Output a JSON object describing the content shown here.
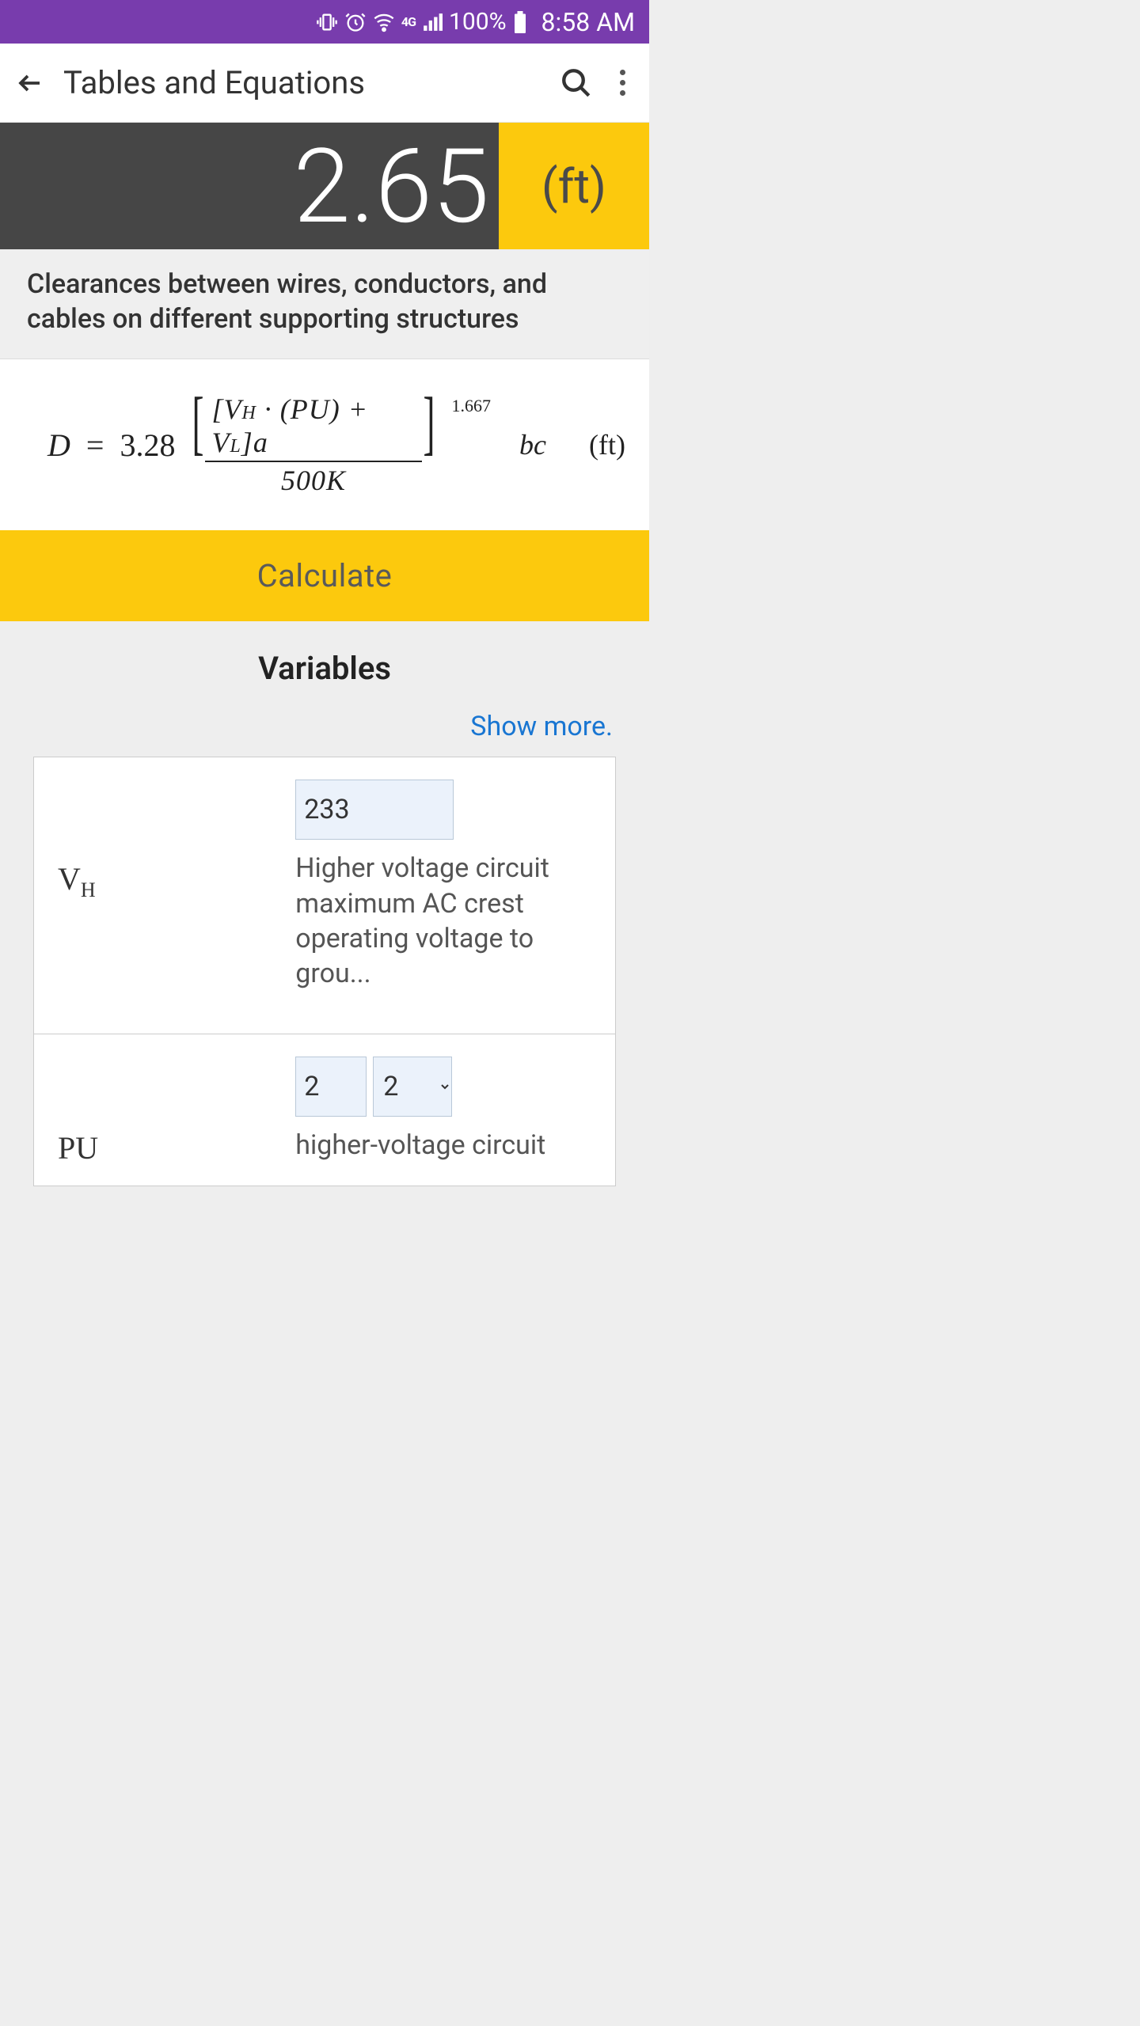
{
  "status": {
    "network_indicator": "4G",
    "battery_pct": "100%",
    "time": "8:58 AM"
  },
  "appbar": {
    "title": "Tables and Equations"
  },
  "result": {
    "value": "2.65",
    "unit": "(ft)"
  },
  "subtitle": "Clearances between wires, conductors, and cables on different supporting structures",
  "equation": {
    "lhs": "D",
    "equals": "=",
    "const": "3.28",
    "numerator": "[V_H · (PU) + V_L]a",
    "denominator": "500K",
    "exponent": "1.667",
    "extra": "bc",
    "unit": "(ft)"
  },
  "calc_label": "Calculate",
  "variables": {
    "heading": "Variables",
    "show_more": "Show more.",
    "rows": [
      {
        "label_html": "V_H",
        "input_value": "233",
        "desc": "Higher voltage circuit maximum AC crest operating voltage to grou..."
      },
      {
        "label_html": "PU",
        "input_value": "2",
        "select_value": "2",
        "desc": "higher-voltage circuit"
      }
    ]
  }
}
